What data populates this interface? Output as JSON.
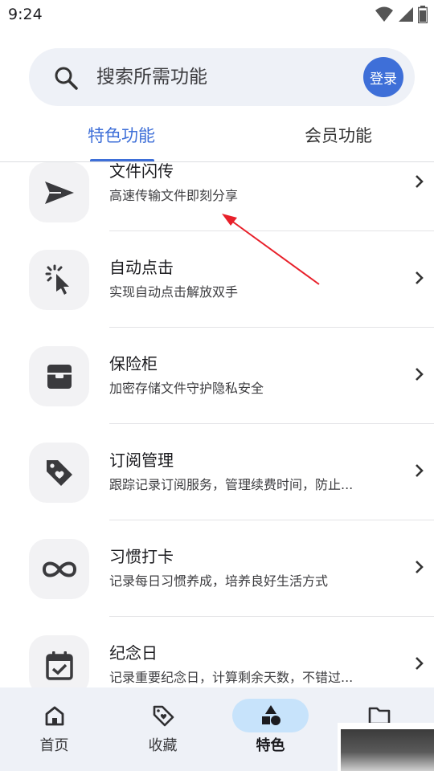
{
  "status_bar": {
    "time": "9:24"
  },
  "search": {
    "placeholder": "搜索所需功能",
    "login_label": "登录"
  },
  "tabs": [
    {
      "label": "特色功能",
      "active": true
    },
    {
      "label": "会员功能",
      "active": false
    }
  ],
  "features": [
    {
      "title": "文件闪传",
      "description": "高速传输文件即刻分享",
      "icon": "send-icon"
    },
    {
      "title": "自动点击",
      "description": "实现自动点击解放双手",
      "icon": "auto-click-icon"
    },
    {
      "title": "保险柜",
      "description": "加密存储文件守护隐私安全",
      "icon": "safe-box-icon"
    },
    {
      "title": "订阅管理",
      "description": "跟踪记录订阅服务，管理续费时间，防止...",
      "icon": "price-tag-heart-icon"
    },
    {
      "title": "习惯打卡",
      "description": "记录每日习惯养成，培养良好生活方式",
      "icon": "infinity-icon"
    },
    {
      "title": "纪念日",
      "description": "记录重要纪念日，计算剩余天数，不错过...",
      "icon": "calendar-check-icon"
    }
  ],
  "bottom_nav": [
    {
      "label": "首页",
      "icon": "home-icon",
      "active": false
    },
    {
      "label": "收藏",
      "icon": "favorite-tag-icon",
      "active": false
    },
    {
      "label": "特色",
      "icon": "shapes-icon",
      "active": true
    },
    {
      "label": "",
      "icon": "folder-icon",
      "active": false
    }
  ],
  "colors": {
    "accent": "#3e6fd8",
    "annotation_arrow": "#e8202a",
    "nav_pill": "#c7e3fb"
  }
}
